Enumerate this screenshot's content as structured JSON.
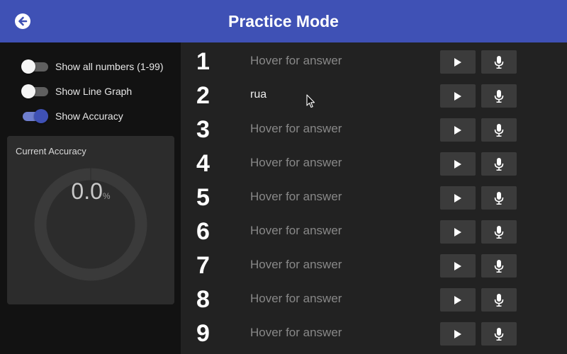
{
  "header": {
    "title": "Practice Mode",
    "back_icon": "arrow-left-circle-icon"
  },
  "sidebar": {
    "toggles": [
      {
        "label": "Show all numbers (1-99)",
        "on": false
      },
      {
        "label": "Show Line Graph",
        "on": false
      },
      {
        "label": "Show Accuracy",
        "on": true
      }
    ],
    "accuracy": {
      "title": "Current Accuracy",
      "value": "0.0",
      "unit": "%",
      "fraction": 0.0
    }
  },
  "practice": {
    "rows": [
      {
        "number": "1",
        "answer": "Hover for answer",
        "revealed": false
      },
      {
        "number": "2",
        "answer": "rua",
        "revealed": true
      },
      {
        "number": "3",
        "answer": "Hover for answer",
        "revealed": false
      },
      {
        "number": "4",
        "answer": "Hover for answer",
        "revealed": false
      },
      {
        "number": "5",
        "answer": "Hover for answer",
        "revealed": false
      },
      {
        "number": "6",
        "answer": "Hover for answer",
        "revealed": false
      },
      {
        "number": "7",
        "answer": "Hover for answer",
        "revealed": false
      },
      {
        "number": "8",
        "answer": "Hover for answer",
        "revealed": false
      },
      {
        "number": "9",
        "answer": "Hover for answer",
        "revealed": false
      }
    ],
    "play_icon": "play-icon",
    "mic_icon": "microphone-icon"
  },
  "colors": {
    "header": "#3f51b5",
    "toggle_on": "#3f51b5",
    "sidebar_bg": "#121212",
    "main_bg": "#222222"
  }
}
